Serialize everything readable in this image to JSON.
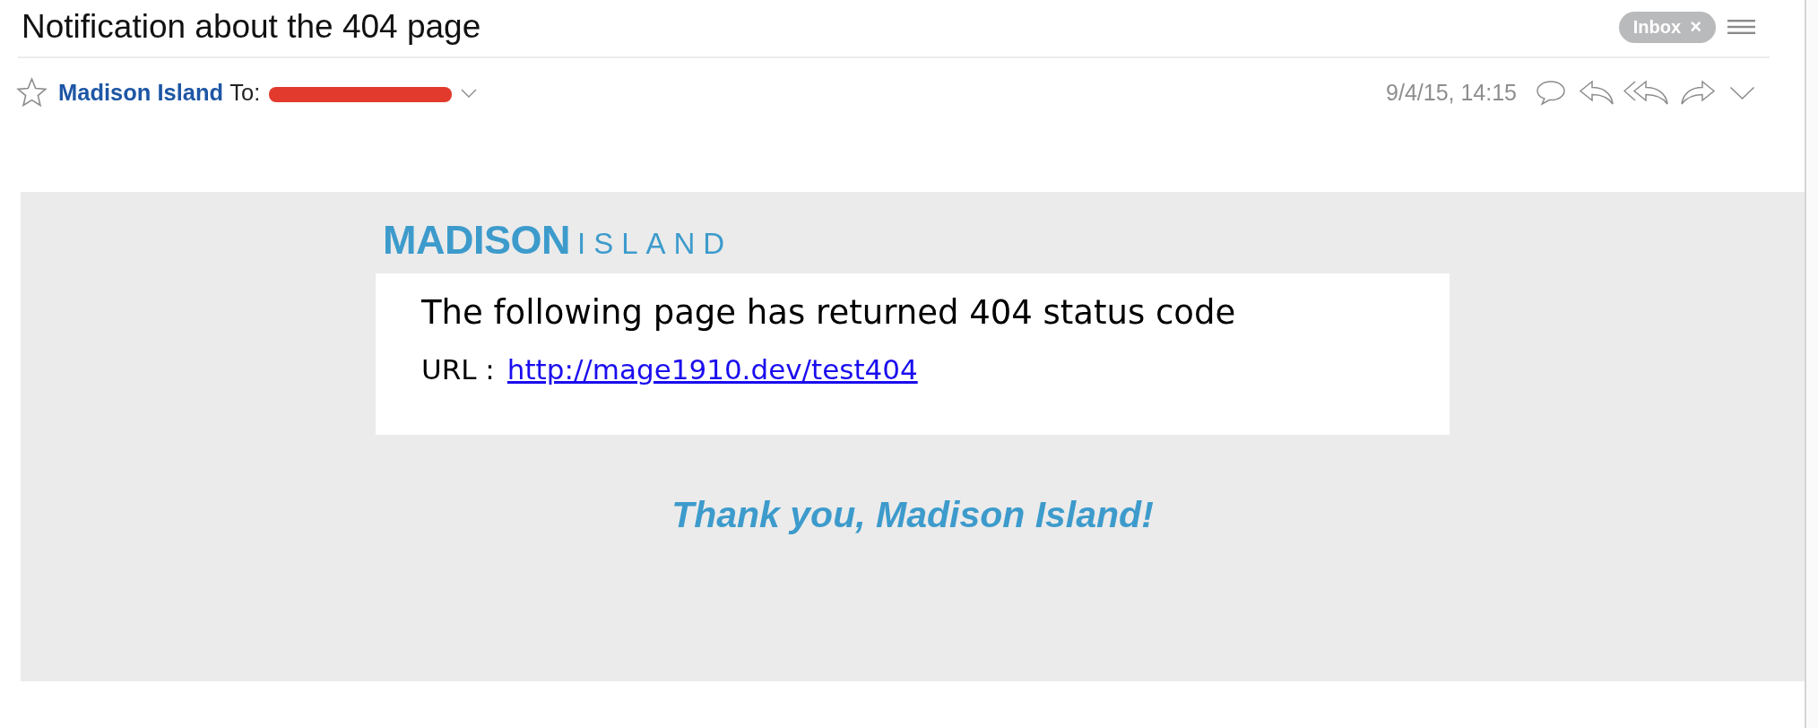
{
  "header": {
    "subject": "Notification about the 404 page",
    "mailbox_tag": {
      "label": "Inbox",
      "remove": "×"
    }
  },
  "message": {
    "starred": false,
    "sender": "Madison Island",
    "to_label": "To:",
    "date": "9/4/15, 14:15"
  },
  "email_body": {
    "logo": {
      "bold": "MADISON",
      "light": "ISLAND"
    },
    "heading": "The following page has returned 404 status code",
    "url_label": "URL :",
    "url": "http://mage1910.dev/test404",
    "closing": "Thank you, Madison Island!"
  }
}
